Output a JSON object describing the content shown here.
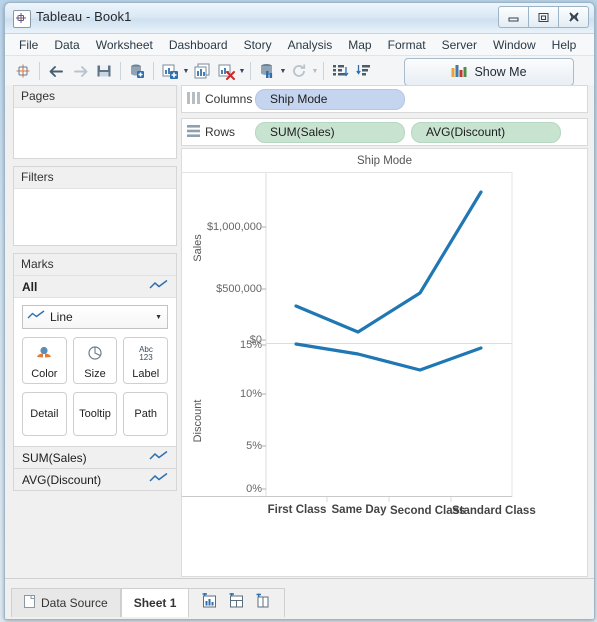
{
  "window": {
    "title": "Tableau - Book1",
    "app_icon": "tableau-logo-icon",
    "minimize": "minimize-icon",
    "maximize": "maximize-icon",
    "close": "close-icon"
  },
  "menubar": {
    "items": [
      "File",
      "Data",
      "Worksheet",
      "Dashboard",
      "Story",
      "Analysis",
      "Map",
      "Format",
      "Server",
      "Window",
      "Help"
    ]
  },
  "toolbar": {
    "buttons": [
      "tableau-sparkle-icon",
      "back-arrow-icon",
      "forward-arrow-icon",
      "save-icon",
      "new-data-source-icon",
      "new-worksheet-icon",
      "duplicate-sheet-icon",
      "clear-sheet-icon",
      "swap-rows-columns-icon",
      "refresh-icon",
      "sort-ascending-icon",
      "sort-descending-icon"
    ],
    "show_me_label": "Show Me",
    "show_me_icon": "show-me-bars-icon"
  },
  "sidebar": {
    "pages": {
      "title": "Pages"
    },
    "filters": {
      "title": "Filters"
    },
    "marks": {
      "title": "Marks",
      "all_label": "All",
      "all_icon": "line-mark-icon",
      "mark_type": "Line",
      "mark_type_icon": "line-mark-icon",
      "dropdown_icon": "chevron-down-icon",
      "buttons": [
        {
          "label": "Color",
          "icon": "color-palette-icon"
        },
        {
          "label": "Size",
          "icon": "size-circle-icon"
        },
        {
          "label": "Label",
          "icon": "abc-123-icon"
        },
        {
          "label": "Detail",
          "icon": "detail-icon"
        },
        {
          "label": "Tooltip",
          "icon": "tooltip-icon"
        },
        {
          "label": "Path",
          "icon": "path-icon"
        }
      ],
      "measure_cards": [
        {
          "label": "SUM(Sales)",
          "icon": "line-mark-icon"
        },
        {
          "label": "AVG(Discount)",
          "icon": "line-mark-icon"
        }
      ]
    }
  },
  "shelves": {
    "columns": {
      "label": "Columns",
      "icon": "columns-icon",
      "pills": [
        "Ship Mode"
      ]
    },
    "rows": {
      "label": "Rows",
      "icon": "rows-icon",
      "pills": [
        "SUM(Sales)",
        "AVG(Discount)"
      ]
    }
  },
  "statusbar": {
    "data_source_tab": "Data Source",
    "data_source_icon": "data-source-icon",
    "sheet_tab": "Sheet 1",
    "new_worksheet_icon": "new-worksheet-tab-icon",
    "new_dashboard_icon": "new-dashboard-tab-icon",
    "new_story_icon": "new-story-tab-icon"
  },
  "colors": {
    "line": "#1f77b4",
    "dimension_pill": "#c5d5ef",
    "measure_pill": "#c9e3d1"
  },
  "chart_data": [
    {
      "type": "line",
      "title": "Ship Mode",
      "xlabel": "",
      "ylabel": "Sales",
      "categories": [
        "First Class",
        "Same Day",
        "Second Class",
        "Standard Class"
      ],
      "values": [
        330000,
        70000,
        460000,
        1270000
      ],
      "ytick_labels": [
        "$0",
        "$500,000",
        "$1,000,000"
      ],
      "ytick_values": [
        0,
        500000,
        1000000
      ],
      "ylim": [
        0,
        1400000
      ],
      "grid": false,
      "legend": "none",
      "series_color": "#1f77b4"
    },
    {
      "type": "line",
      "title": "",
      "xlabel": "Ship Mode",
      "ylabel": "Discount",
      "categories": [
        "First Class",
        "Same Day",
        "Second Class",
        "Standard Class"
      ],
      "values": [
        0.1655,
        0.1553,
        0.139,
        0.1622
      ],
      "ytick_labels": [
        "0%",
        "5%",
        "10%",
        "15%"
      ],
      "ytick_values": [
        0,
        0.05,
        0.1,
        0.15
      ],
      "ylim": [
        0,
        0.175
      ],
      "grid": false,
      "legend": "none",
      "series_color": "#1f77b4"
    }
  ]
}
